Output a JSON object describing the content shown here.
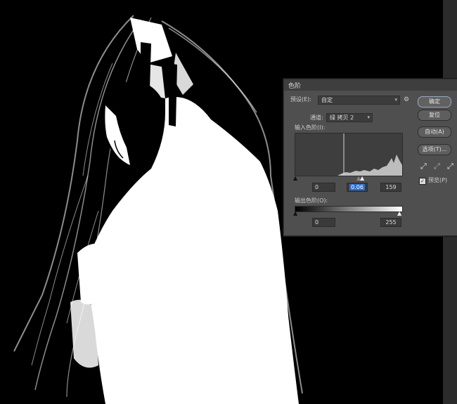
{
  "dialog": {
    "title": "色阶",
    "preset_label": "预设(E):",
    "preset_value": "自定",
    "channel_label": "通道:",
    "channel_value": "绿 拷贝 2",
    "input_levels_label": "输入色阶(I):",
    "input_values": [
      "0",
      "0.06",
      "159"
    ],
    "output_levels_label": "输出色阶(O):",
    "output_values": [
      "0",
      "255"
    ],
    "buttons": {
      "ok": "确定",
      "reset": "复位",
      "auto": "自动(A)",
      "options": "选项(T)..."
    },
    "preview_label": "预览(P)",
    "preview_checked": true
  },
  "icons": [
    "gear-icon",
    "black-eyedropper-icon",
    "gray-eyedropper-icon",
    "white-eyedropper-icon"
  ]
}
